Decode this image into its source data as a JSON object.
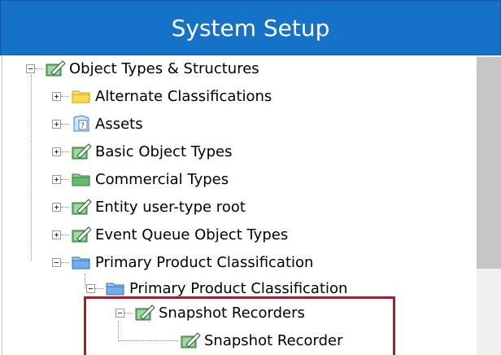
{
  "header": {
    "title": "System Setup"
  },
  "tree": {
    "root": "Object Types & Structures",
    "children": [
      "Alternate Classifications",
      "Assets",
      "Basic Object Types",
      "Commercial Types",
      "Entity user-type root",
      "Event Queue Object Types",
      "Primary Product Classification"
    ],
    "sub_child": "Primary Product Classification",
    "snapshot_recorders": "Snapshot Recorders",
    "snapshot_recorder": "Snapshot Recorder"
  },
  "colors": {
    "header": "#1672c6",
    "highlight": "#a02030"
  }
}
